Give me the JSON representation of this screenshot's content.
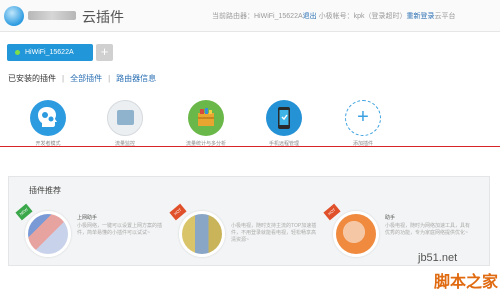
{
  "header": {
    "title": "云插件",
    "info_prefix": "当前路由器：HiWiFi_15622A",
    "logout": "退出",
    "account": "小极帐号：kpk（登录超时）",
    "relogin": "重新登录",
    "cloud": "云平台"
  },
  "routers": {
    "active": "HiWiFi_15622A",
    "add": "+"
  },
  "filters": {
    "installed": "已安装的插件",
    "all": "全部插件",
    "router_info": "路由器信息",
    "sep": "|"
  },
  "installed_plugins": [
    {
      "label": "开发者模式",
      "icon": "head-gears-icon"
    },
    {
      "label": "流量监控",
      "icon": "monitor-icon"
    },
    {
      "label": "流量统计与多分析",
      "icon": "gift-box-icon"
    },
    {
      "label": "手机远程管理",
      "icon": "phone-icon"
    },
    {
      "label": "添加插件",
      "icon": "plus-icon"
    }
  ],
  "recommend": {
    "title": "插件推荐",
    "items": [
      {
        "ribbon": "NEW",
        "ribbon_color": "#3aa84a",
        "name": "上网助手",
        "desc": "小极网络，一键可以设置上网方案的插件，简单易懂的小插件可以试试~"
      },
      {
        "ribbon": "HOT",
        "ribbon_color": "#e0502a",
        "name": "",
        "desc": "小极电视，随时支持主流的TOP加速插件，不用登录就能看电视，轻松畅享高清资源~"
      },
      {
        "ribbon": "HOT",
        "ribbon_color": "#e0502a",
        "name": "助手",
        "desc": "小极电视，随时为网络加速工具，具有优秀的功能，专为家庭网络提供优化~"
      }
    ]
  },
  "watermark": {
    "site": "jb51.net",
    "name": "脚本之家"
  }
}
